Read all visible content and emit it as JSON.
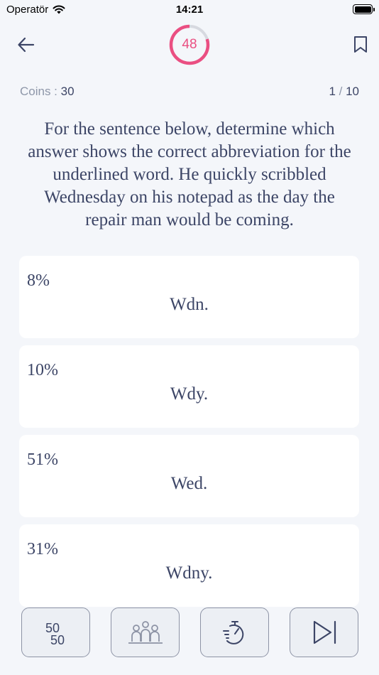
{
  "status_bar": {
    "carrier": "Operatör",
    "time": "14:21"
  },
  "header": {
    "timer_value": "48",
    "timer_fraction_remaining": 0.8,
    "accent_color": "#ea4f82"
  },
  "stats": {
    "coins_label": "Coins : ",
    "coins_value": "30",
    "progress_current": "1",
    "progress_separator": " / ",
    "progress_total": "10"
  },
  "question": "For the sentence below, determine which answer shows the correct abbreviation for the underlined word. He quickly scribbled Wednesday on his notepad as the day the repair man would be coming.",
  "options": [
    {
      "percent": "8%",
      "answer": "Wdn."
    },
    {
      "percent": "10%",
      "answer": "Wdy."
    },
    {
      "percent": "51%",
      "answer": "Wed."
    },
    {
      "percent": "31%",
      "answer": "Wdny."
    }
  ],
  "lifelines": {
    "fifty_fifty_top": "50",
    "fifty_fifty_bottom": "50",
    "icons": [
      "fifty-fifty-icon",
      "audience-icon",
      "stopwatch-icon",
      "skip-icon"
    ]
  }
}
